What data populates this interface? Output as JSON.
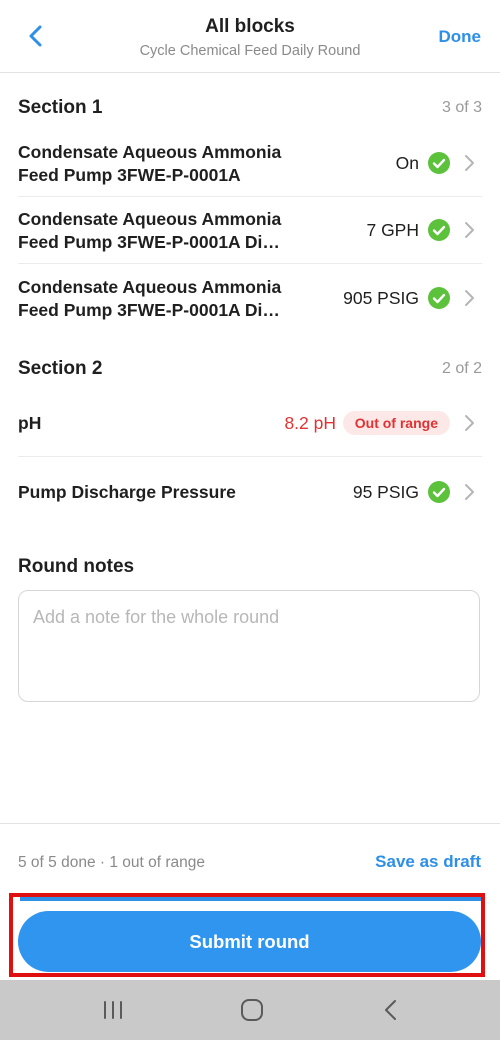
{
  "header": {
    "title": "All blocks",
    "subtitle": "Cycle Chemical Feed Daily Round",
    "done_label": "Done"
  },
  "sections": [
    {
      "title": "Section 1",
      "count": "3 of 3",
      "rows": [
        {
          "line1": "Condensate Aqueous Ammonia",
          "line2": "Feed Pump 3FWE-P-0001A",
          "value": "On"
        },
        {
          "line1": "Condensate Aqueous Ammonia",
          "line2": "Feed Pump 3FWE-P-0001A Di…",
          "value": "7 GPH"
        },
        {
          "line1": "Condensate Aqueous Ammonia",
          "line2": "Feed Pump 3FWE-P-0001A Di…",
          "value": "905 PSIG"
        }
      ]
    },
    {
      "title": "Section 2",
      "count": "2 of 2",
      "rows": [
        {
          "line1": "pH",
          "value": "8.2 pH",
          "badge": "Out of range"
        },
        {
          "line1": "Pump Discharge Pressure",
          "value": "95 PSIG"
        }
      ]
    }
  ],
  "notes": {
    "title": "Round notes",
    "placeholder": "Add a note for the whole round"
  },
  "footer": {
    "status": "5 of 5 done · 1 out of range",
    "save_draft_label": "Save as draft",
    "submit_label": "Submit round"
  },
  "colors": {
    "accent": "#2d8fe6",
    "success": "#5cc13b",
    "danger": "#e03232",
    "badge_bg": "#fde8e8"
  },
  "icons": {
    "back": "chevron-left-icon",
    "check": "check-circle-icon",
    "row_chevron": "chevron-right-icon",
    "nav": [
      "recent-apps-icon",
      "home-icon",
      "back-nav-icon"
    ]
  }
}
